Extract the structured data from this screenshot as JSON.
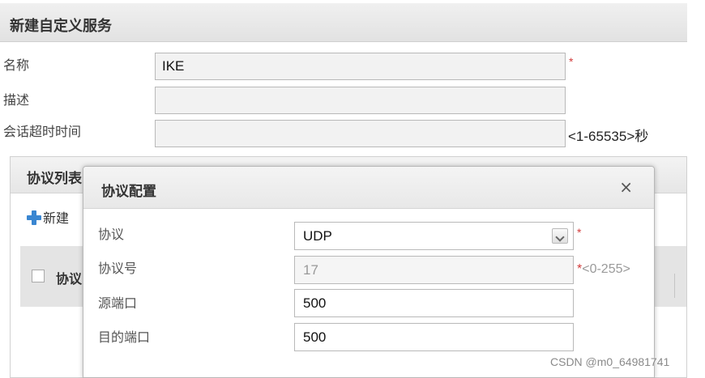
{
  "outer": {
    "title": "新建自定义服务",
    "fields": {
      "name_label": "名称",
      "name_value": "IKE",
      "desc_label": "描述",
      "desc_value": "",
      "timeout_label": "会话超时时间",
      "timeout_value": "",
      "timeout_hint": "<1-65535>秒",
      "required_mark": "*"
    }
  },
  "list": {
    "title": "协议列表",
    "new_button": "新建",
    "column_protocol": "协议"
  },
  "modal": {
    "title": "协议配置",
    "close": "×",
    "protocol_label": "协议",
    "protocol_value": "UDP",
    "protocol_required": "*",
    "protocol_number_label": "协议号",
    "protocol_number_value": "17",
    "protocol_number_hint": "*<0-255>",
    "source_port_label": "源端口",
    "source_port_value": "500",
    "dest_port_label": "目的端口",
    "dest_port_value": "500"
  },
  "watermark": "CSDN @m0_64981741",
  "colors": {
    "required": "#d23c3c",
    "accent_icon": "#3a86d1"
  }
}
